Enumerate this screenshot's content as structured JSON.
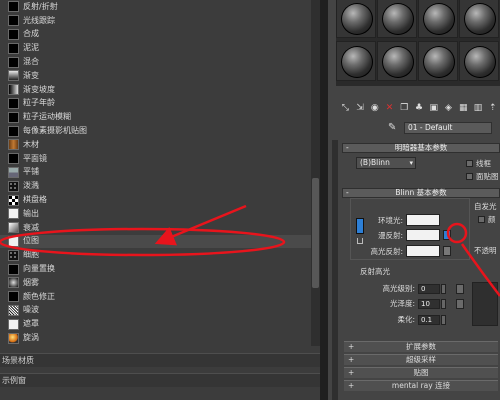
{
  "map_list": {
    "items": [
      {
        "label": "反射/折射",
        "swatch": "sw-black"
      },
      {
        "label": "光线跟踪",
        "swatch": "sw-black"
      },
      {
        "label": "合成",
        "swatch": "sw-black"
      },
      {
        "label": "泥泥",
        "swatch": "sw-black"
      },
      {
        "label": "混合",
        "swatch": "sw-black"
      },
      {
        "label": "渐变",
        "swatch": "sw-grad"
      },
      {
        "label": "渐变坡度",
        "swatch": "sw-grad2"
      },
      {
        "label": "粒子年龄",
        "swatch": "sw-black"
      },
      {
        "label": "粒子运动模糊",
        "swatch": "sw-black"
      },
      {
        "label": "每像素摄影机贴图",
        "swatch": "sw-black"
      },
      {
        "label": "木材",
        "swatch": "sw-wood"
      },
      {
        "label": "平面镜",
        "swatch": "sw-black"
      },
      {
        "label": "平铺",
        "swatch": "sw-tile"
      },
      {
        "label": "泼溅",
        "swatch": "sw-dots"
      },
      {
        "label": "棋盘格",
        "swatch": "sw-check"
      },
      {
        "label": "输出",
        "swatch": "sw-white"
      },
      {
        "label": "衰减",
        "swatch": "sw-fade"
      },
      {
        "label": "位图",
        "swatch": "sw-bmp"
      },
      {
        "label": "细胞",
        "swatch": "sw-dots"
      },
      {
        "label": "向量置换",
        "swatch": "sw-black"
      },
      {
        "label": "烟雾",
        "swatch": "sw-smoke"
      },
      {
        "label": "颜色修正",
        "swatch": "sw-black"
      },
      {
        "label": "噪波",
        "swatch": "sw-noise"
      },
      {
        "label": "遮罩",
        "swatch": "sw-white"
      },
      {
        "label": "旋涡",
        "swatch": "sw-orb"
      }
    ],
    "selected_index": 17
  },
  "sections": {
    "scene_materials": "场景材质",
    "sample_slots": "示例窗"
  },
  "material": {
    "name": "01 - Default"
  },
  "shader_basic": {
    "title": "明暗器基本参数",
    "shader": "(B)Blinn",
    "wire_label": "线框",
    "faceted_label": "面贴图"
  },
  "blinn_basic": {
    "title": "Blinn 基本参数",
    "ambient_label": "环境光:",
    "diffuse_label": "漫反射:",
    "specular_label": "高光反射:",
    "self_illum_label": "自发光",
    "color_label": "颜",
    "opacity_label": "不透明",
    "specular_highlights_title": "反射高光",
    "specular_level_label": "高光级别:",
    "specular_level_value": "0",
    "glossiness_label": "光泽度:",
    "glossiness_value": "10",
    "soften_label": "柔化:",
    "soften_value": "0.1"
  },
  "rollouts": [
    {
      "label": "扩展参数"
    },
    {
      "label": "超级采样"
    },
    {
      "label": "贴图"
    },
    {
      "label": "mental ray 连接"
    }
  ],
  "colors": {
    "annotation_red": "#e8141c",
    "lock_blue": "#2d7fd6"
  }
}
